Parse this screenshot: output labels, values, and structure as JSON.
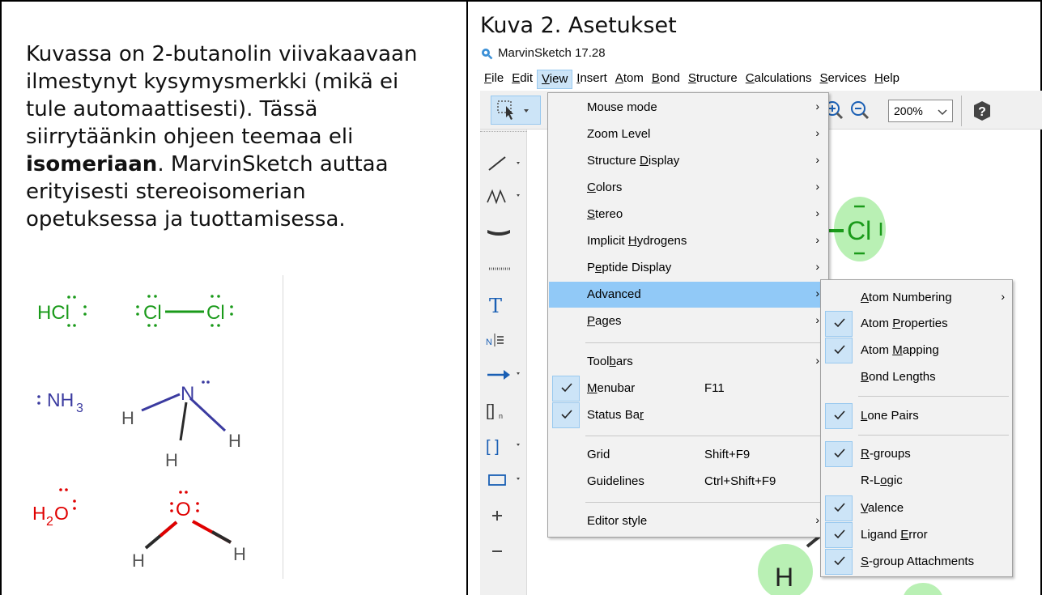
{
  "left": {
    "line1": "Kuvassa on 2-butanolin viivakaavaan",
    "line2": "ilmestynyt kysymysmerkki (mikä ei",
    "line3": "tule automaattisesti). Tässä",
    "line4": "siirrytäänkin ohjeen teemaa eli",
    "line5_bold": "isomeriaan",
    "line5_rest": ". MarvinSketch auttaa",
    "line6": "erityisesti stereoisomerian",
    "line7": "opetuksessa ja tuottamisessa.",
    "molecules": {
      "hcl": "HCl",
      "cl2_left": "Cl",
      "cl2_right": "Cl",
      "nh3_label": "NH",
      "nh3_sub": "3",
      "n_atom": "N",
      "h_atom": "H",
      "h2o_h": "H",
      "h2o_sub": "2",
      "h2o_o": "O",
      "o_atom": "O"
    }
  },
  "right": {
    "figure_title": "Kuva 2. Asetukset",
    "app_title": "MarvinSketch 17.28",
    "menubar": [
      {
        "pre": "",
        "u": "F",
        "post": "ile"
      },
      {
        "pre": "",
        "u": "E",
        "post": "dit"
      },
      {
        "pre": "",
        "u": "V",
        "post": "iew"
      },
      {
        "pre": "",
        "u": "I",
        "post": "nsert"
      },
      {
        "pre": "",
        "u": "A",
        "post": "tom"
      },
      {
        "pre": "",
        "u": "B",
        "post": "ond"
      },
      {
        "pre": "",
        "u": "S",
        "post": "tructure"
      },
      {
        "pre": "",
        "u": "C",
        "post": "alculations"
      },
      {
        "pre": "",
        "u": "S",
        "post": "ervices"
      },
      {
        "pre": "",
        "u": "H",
        "post": "elp"
      }
    ],
    "zoom_value": "200%",
    "canvas_atom_cl": "Cl",
    "canvas_atom_h": "H",
    "view_menu": {
      "mouse_mode": "Mouse mode",
      "zoom_level": "Zoom Level",
      "structure_display_pre": "Structure ",
      "structure_display_u": "D",
      "structure_display_post": "isplay",
      "colors_u": "C",
      "colors_post": "olors",
      "stereo_u": "S",
      "stereo_post": "tereo",
      "implicit_pre": "Implicit ",
      "implicit_u": "H",
      "implicit_post": "ydrogens",
      "peptide_pre": "P",
      "peptide_u": "e",
      "peptide_post": "ptide Display",
      "advanced": "Advanced",
      "pages_u": "P",
      "pages_post": "ages",
      "toolbars_pre": "Tool",
      "toolbars_u": "b",
      "toolbars_post": "ars",
      "menubar_u": "M",
      "menubar_post": "enubar",
      "menubar_shortcut": "F11",
      "statusbar_pre": "Status Ba",
      "statusbar_u": "r",
      "grid": "Grid",
      "grid_shortcut": "Shift+F9",
      "guidelines": "Guidelines",
      "guidelines_shortcut": "Ctrl+Shift+F9",
      "editor_style": "Editor style"
    },
    "advanced_menu": {
      "atom_numbering_u": "A",
      "atom_numbering_post": "tom Numbering",
      "atom_properties_pre": "Atom ",
      "atom_properties_u": "P",
      "atom_properties_post": "roperties",
      "atom_mapping_pre": "Atom ",
      "atom_mapping_u": "M",
      "atom_mapping_post": "apping",
      "bond_lengths_u": "B",
      "bond_lengths_post": "ond Lengths",
      "lone_pairs_u": "L",
      "lone_pairs_post": "one Pairs",
      "rgroups_u": "R",
      "rgroups_post": "-groups",
      "rlogic_pre": "R-L",
      "rlogic_u": "o",
      "rlogic_post": "gic",
      "valence_u": "V",
      "valence_post": "alence",
      "ligand_pre": "Ligand ",
      "ligand_u": "E",
      "ligand_post": "rror",
      "sgroup_u": "S",
      "sgroup_post": "-group Attachments"
    },
    "colors": {
      "highlight": "#91c9f7",
      "check_bg": "#cce4f7",
      "green": "#1a9a1a",
      "blue": "#3b3ba0",
      "red": "#e00000"
    }
  }
}
